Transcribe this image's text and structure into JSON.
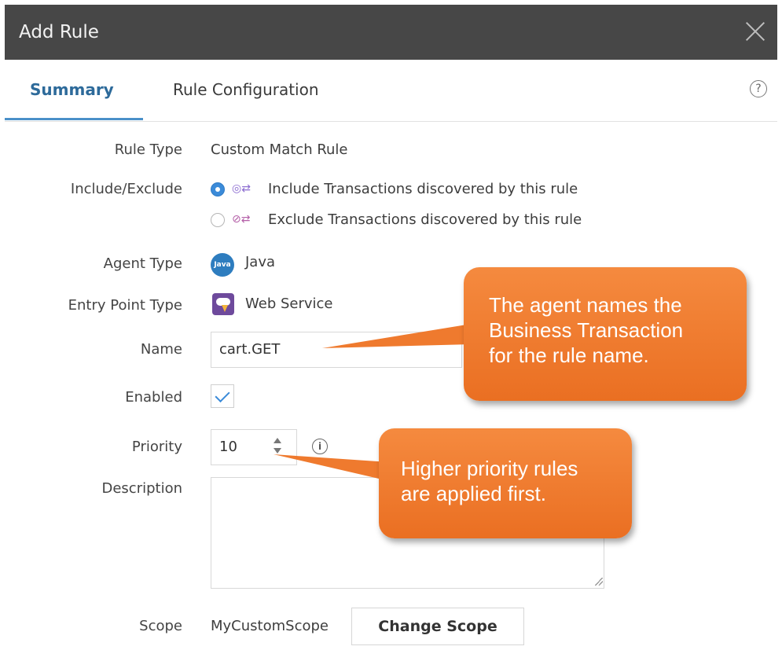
{
  "dialog": {
    "title": "Add Rule"
  },
  "tabs": [
    {
      "label": "Summary",
      "active": true
    },
    {
      "label": "Rule Configuration",
      "active": false
    }
  ],
  "form": {
    "rule_type": {
      "label": "Rule Type",
      "value": "Custom Match Rule"
    },
    "include_exclude": {
      "label": "Include/Exclude",
      "options": [
        {
          "label": "Include Transactions discovered by this rule",
          "selected": true
        },
        {
          "label": "Exclude Transactions discovered by this rule",
          "selected": false
        }
      ]
    },
    "agent_type": {
      "label": "Agent Type",
      "icon": "java-icon",
      "icon_text": "Java",
      "value": "Java"
    },
    "entry_point_type": {
      "label": "Entry Point Type",
      "icon": "web-service-icon",
      "value": "Web Service"
    },
    "name": {
      "label": "Name",
      "value": "cart.GET"
    },
    "enabled": {
      "label": "Enabled",
      "checked": true
    },
    "priority": {
      "label": "Priority",
      "value": "10"
    },
    "description": {
      "label": "Description",
      "value": ""
    },
    "scope": {
      "label": "Scope",
      "value": "MyCustomScope",
      "button": "Change Scope"
    }
  },
  "callouts": [
    {
      "lines": [
        "The agent names the",
        "Business Transaction",
        "for the rule name."
      ]
    },
    {
      "lines": [
        "Higher priority rules",
        "are applied first."
      ]
    }
  ],
  "colors": {
    "titlebar": "#474747",
    "accent": "#3b8bd9",
    "callout": "#ef7a2e"
  }
}
